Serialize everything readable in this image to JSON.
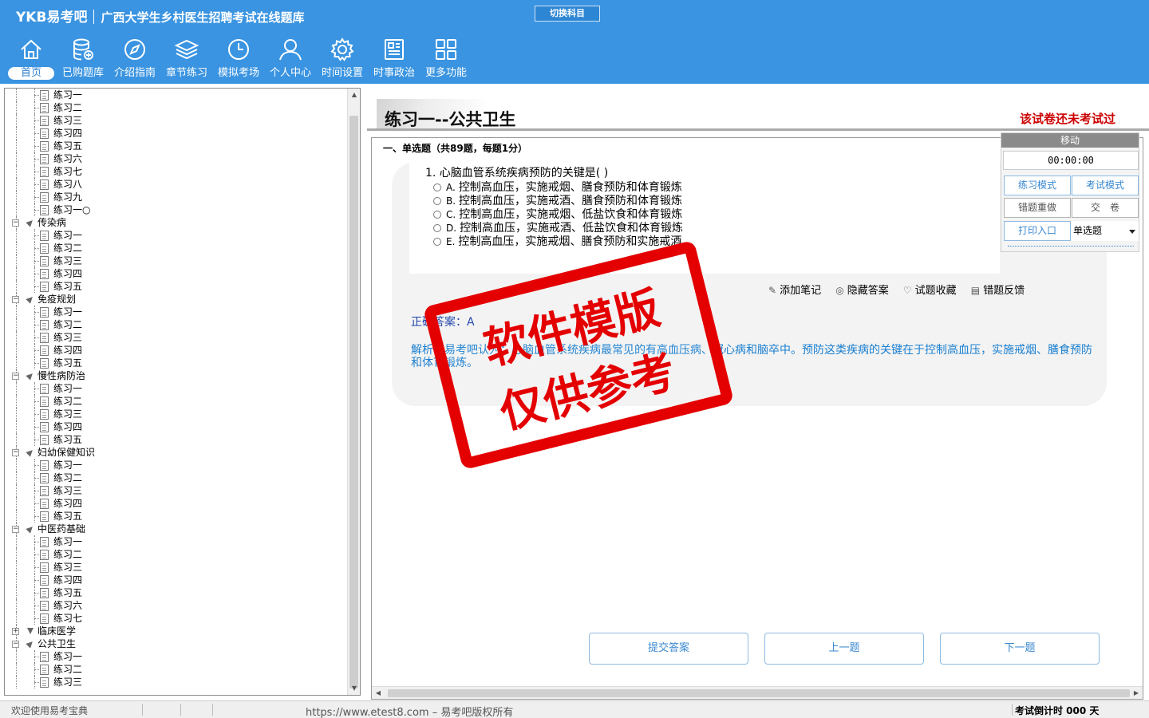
{
  "header": {
    "logo": "YKB易考吧",
    "subtitle": "广西大学生乡村医生招聘考试在线题库",
    "switch_label": "切换科目"
  },
  "nav": [
    {
      "label": "首页",
      "icon": "home-icon",
      "active": true
    },
    {
      "label": "已购题库",
      "icon": "database-add-icon"
    },
    {
      "label": "介绍指南",
      "icon": "compass-icon"
    },
    {
      "label": "章节练习",
      "icon": "layers-icon"
    },
    {
      "label": "模拟考场",
      "icon": "clock-icon"
    },
    {
      "label": "个人中心",
      "icon": "user-icon"
    },
    {
      "label": "时间设置",
      "icon": "gear-icon"
    },
    {
      "label": "时事政治",
      "icon": "news-icon"
    },
    {
      "label": "更多功能",
      "icon": "grid-icon"
    }
  ],
  "tree": [
    {
      "type": "leaf",
      "label": "练习一"
    },
    {
      "type": "leaf",
      "label": "练习二"
    },
    {
      "type": "leaf",
      "label": "练习三"
    },
    {
      "type": "leaf",
      "label": "练习四"
    },
    {
      "type": "leaf",
      "label": "练习五"
    },
    {
      "type": "leaf",
      "label": "练习六"
    },
    {
      "type": "leaf",
      "label": "练习七"
    },
    {
      "type": "leaf",
      "label": "练习八"
    },
    {
      "type": "leaf",
      "label": "练习九"
    },
    {
      "type": "leaf",
      "label": "练习一○"
    },
    {
      "type": "group",
      "label": "传染病",
      "open": true
    },
    {
      "type": "leaf",
      "label": "练习一"
    },
    {
      "type": "leaf",
      "label": "练习二"
    },
    {
      "type": "leaf",
      "label": "练习三"
    },
    {
      "type": "leaf",
      "label": "练习四"
    },
    {
      "type": "leaf",
      "label": "练习五"
    },
    {
      "type": "group",
      "label": "免疫规划",
      "open": true
    },
    {
      "type": "leaf",
      "label": "练习一"
    },
    {
      "type": "leaf",
      "label": "练习二"
    },
    {
      "type": "leaf",
      "label": "练习三"
    },
    {
      "type": "leaf",
      "label": "练习四"
    },
    {
      "type": "leaf",
      "label": "练习五"
    },
    {
      "type": "group",
      "label": "慢性病防治",
      "open": true
    },
    {
      "type": "leaf",
      "label": "练习一"
    },
    {
      "type": "leaf",
      "label": "练习二"
    },
    {
      "type": "leaf",
      "label": "练习三"
    },
    {
      "type": "leaf",
      "label": "练习四"
    },
    {
      "type": "leaf",
      "label": "练习五"
    },
    {
      "type": "group",
      "label": "妇幼保健知识",
      "open": true
    },
    {
      "type": "leaf",
      "label": "练习一"
    },
    {
      "type": "leaf",
      "label": "练习二"
    },
    {
      "type": "leaf",
      "label": "练习三"
    },
    {
      "type": "leaf",
      "label": "练习四"
    },
    {
      "type": "leaf",
      "label": "练习五"
    },
    {
      "type": "group",
      "label": "中医药基础",
      "open": true
    },
    {
      "type": "leaf",
      "label": "练习一"
    },
    {
      "type": "leaf",
      "label": "练习二"
    },
    {
      "type": "leaf",
      "label": "练习三"
    },
    {
      "type": "leaf",
      "label": "练习四"
    },
    {
      "type": "leaf",
      "label": "练习五"
    },
    {
      "type": "leaf",
      "label": "练习六"
    },
    {
      "type": "leaf",
      "label": "练习七"
    },
    {
      "type": "group",
      "label": "临床医学",
      "open": false
    },
    {
      "type": "group",
      "label": "公共卫生",
      "open": true
    },
    {
      "type": "leaf",
      "label": "练习一"
    },
    {
      "type": "leaf",
      "label": "练习二"
    },
    {
      "type": "leaf",
      "label": "练习三"
    }
  ],
  "main": {
    "title": "练习一--公共卫生",
    "status": "该试卷还未考试过",
    "section": "一、单选题（共89题，每题1分）",
    "question": "1. 心脑血管系统疾病预防的关键是( )",
    "options": [
      {
        "letter": "A.",
        "text": "控制高血压，实施戒烟、膳食预防和体育锻炼"
      },
      {
        "letter": "B.",
        "text": "控制高血压，实施戒酒、膳食预防和体育锻炼"
      },
      {
        "letter": "C.",
        "text": "控制高血压，实施戒烟、低盐饮食和体育锻炼"
      },
      {
        "letter": "D.",
        "text": "控制高血压，实施戒酒、低盐饮食和体育锻炼"
      },
      {
        "letter": "E.",
        "text": "控制高血压，实施戒烟、膳食预防和实施戒酒"
      }
    ],
    "tools": {
      "note": "添加笔记",
      "hide": "隐藏答案",
      "fav": "试题收藏",
      "feedback": "错题反馈"
    },
    "answer": "正确答案：A",
    "analysis": "解析：易考吧认为：心脑血管系统疾病最常见的有高血压病、冠心病和脑卒中。预防这类疾病的关键在于控制高血压，实施戒烟、膳食预防和体育锻炼。",
    "stamp": [
      "软件模版",
      "仅供参考"
    ],
    "buttons": {
      "submit": "提交答案",
      "prev": "上一题",
      "next": "下一题"
    }
  },
  "control": {
    "move": "移动",
    "timer": "00:00:00",
    "practice": "练习模式",
    "exam": "考试模式",
    "redo": "错题重做",
    "hand_in": "交　卷",
    "print": "打印入口",
    "type_select": "单选题"
  },
  "statusbar": {
    "welcome": "欢迎使用易考宝典",
    "copyright": "https://www.etest8.com – 易考吧版权所有",
    "countdown": "考试倒计时 000 天"
  },
  "colors": {
    "header": "#3a94e1",
    "stamp": "#e40000",
    "status_red": "#cc0000",
    "answer_blue": "#1a3fa6",
    "analysis_blue": "#1a7fd0"
  }
}
